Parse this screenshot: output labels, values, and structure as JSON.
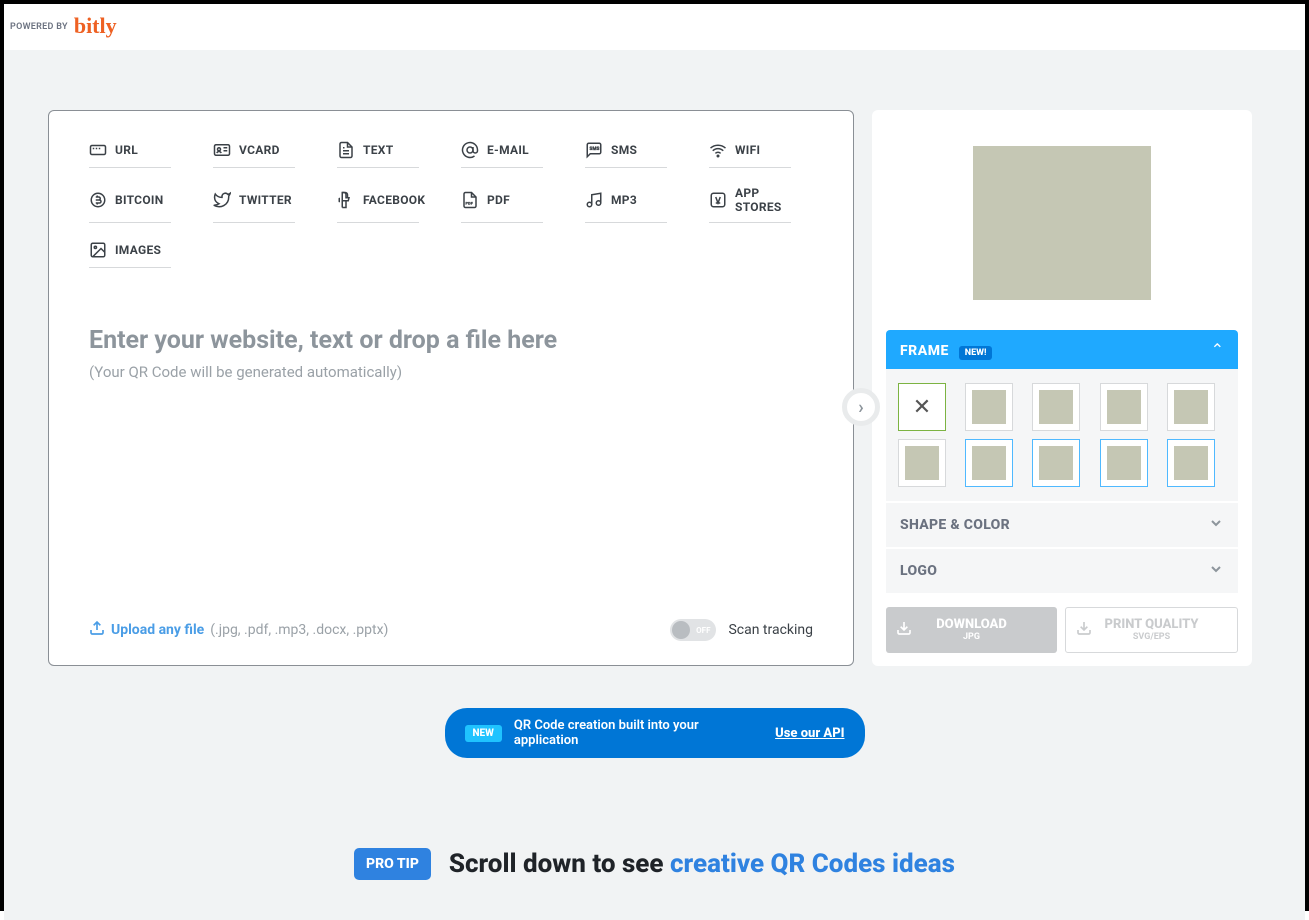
{
  "header": {
    "powered_by": "POWERED BY",
    "brand": "bitly"
  },
  "tabs": [
    {
      "id": "url",
      "label": "URL"
    },
    {
      "id": "vcard",
      "label": "VCARD"
    },
    {
      "id": "text",
      "label": "TEXT"
    },
    {
      "id": "email",
      "label": "E-MAIL"
    },
    {
      "id": "sms",
      "label": "SMS"
    },
    {
      "id": "wifi",
      "label": "WIFI"
    },
    {
      "id": "bitcoin",
      "label": "BITCOIN"
    },
    {
      "id": "twitter",
      "label": "TWITTER"
    },
    {
      "id": "facebook",
      "label": "FACEBOOK"
    },
    {
      "id": "pdf",
      "label": "PDF"
    },
    {
      "id": "mp3",
      "label": "MP3"
    },
    {
      "id": "appstores",
      "label": "APP STORES"
    },
    {
      "id": "images",
      "label": "IMAGES"
    }
  ],
  "input": {
    "placeholder": "Enter your website, text or drop a file here",
    "sub": "(Your QR Code will be generated automatically)"
  },
  "upload": {
    "label": "Upload any file",
    "ext": " (.jpg, .pdf, .mp3, .docx, .pptx)"
  },
  "scan": {
    "toggle_state": "OFF",
    "label": "Scan tracking"
  },
  "sidebar": {
    "frame": {
      "title": "FRAME",
      "badge": "NEW!"
    },
    "shape": {
      "title": "SHAPE & COLOR"
    },
    "logo": {
      "title": "LOGO"
    },
    "download": {
      "label": "DOWNLOAD",
      "sub": "JPG"
    },
    "print": {
      "label": "PRINT QUALITY",
      "sub": "SVG/EPS"
    }
  },
  "api": {
    "badge": "NEW",
    "text": "QR Code creation built into your application",
    "link": "Use our API"
  },
  "protip": {
    "badge": "PRO TIP",
    "text_prefix": "Scroll down to see ",
    "text_link": "creative QR Codes ideas"
  },
  "colors": {
    "accent_blue": "#1fa9ff",
    "brand_orange": "#ee6123",
    "link_blue": "#2f82e0"
  }
}
